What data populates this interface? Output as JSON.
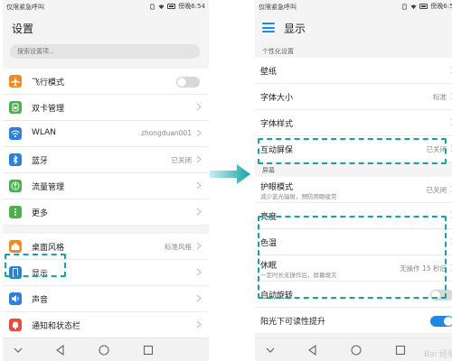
{
  "left": {
    "status": {
      "carrier": "仅限紧急呼叫",
      "time": "6:54"
    },
    "title": "设置",
    "search_placeholder": "搜索设置项...",
    "items": [
      {
        "label": "飞行模式",
        "value": "",
        "icon": "airplane-icon",
        "color": "#f08a24"
      },
      {
        "label": "双卡管理",
        "value": "",
        "icon": "dual-sim-icon",
        "color": "#4caf50"
      },
      {
        "label": "WLAN",
        "value": "zhongduan001",
        "icon": "wifi-icon",
        "color": "#2e7fd8"
      },
      {
        "label": "蓝牙",
        "value": "已关闭",
        "icon": "bluetooth-icon",
        "color": "#2e7fd8"
      },
      {
        "label": "流量管理",
        "value": "",
        "icon": "data-usage-icon",
        "color": "#4caf50"
      },
      {
        "label": "更多",
        "value": "",
        "icon": "more-icon",
        "color": "#4caf50"
      },
      {
        "label": "桌面风格",
        "value": "标准风格",
        "icon": "home-style-icon",
        "color": "#f08a24"
      },
      {
        "label": "显示",
        "value": "",
        "icon": "display-icon",
        "color": "#2e7fd8"
      },
      {
        "label": "声音",
        "value": "",
        "icon": "sound-icon",
        "color": "#2e7fd8"
      },
      {
        "label": "通知和状态栏",
        "value": "",
        "icon": "notification-icon",
        "color": "#e94b3c"
      }
    ]
  },
  "right": {
    "status": {
      "carrier": "仅限紧急呼叫",
      "time": "6:54"
    },
    "title": "显示",
    "section_personal": "个性化设置",
    "personal": [
      {
        "label": "壁纸",
        "value": ""
      },
      {
        "label": "字体大小",
        "value": "标准"
      },
      {
        "label": "字体样式",
        "value": ""
      },
      {
        "label": "互动屏保",
        "value": "已关闭"
      }
    ],
    "section_screen": "屏幕",
    "eye": {
      "label": "护眼模式",
      "sub": "减少蓝光辐射，预防用眼疲劳",
      "value": "已关闭"
    },
    "screen": [
      {
        "label": "亮度",
        "value": ""
      },
      {
        "label": "色温",
        "value": ""
      }
    ],
    "sleep": {
      "label": "休眠",
      "sub": "一定时长无操作后，屏幕熄灭",
      "value": "无操作 15 秒后"
    },
    "auto_rotate": {
      "label": "自动旋转",
      "on": false
    },
    "sunlight": {
      "label": "阳光下可读性提升",
      "on": true
    }
  },
  "watermark": "Bai 经验"
}
